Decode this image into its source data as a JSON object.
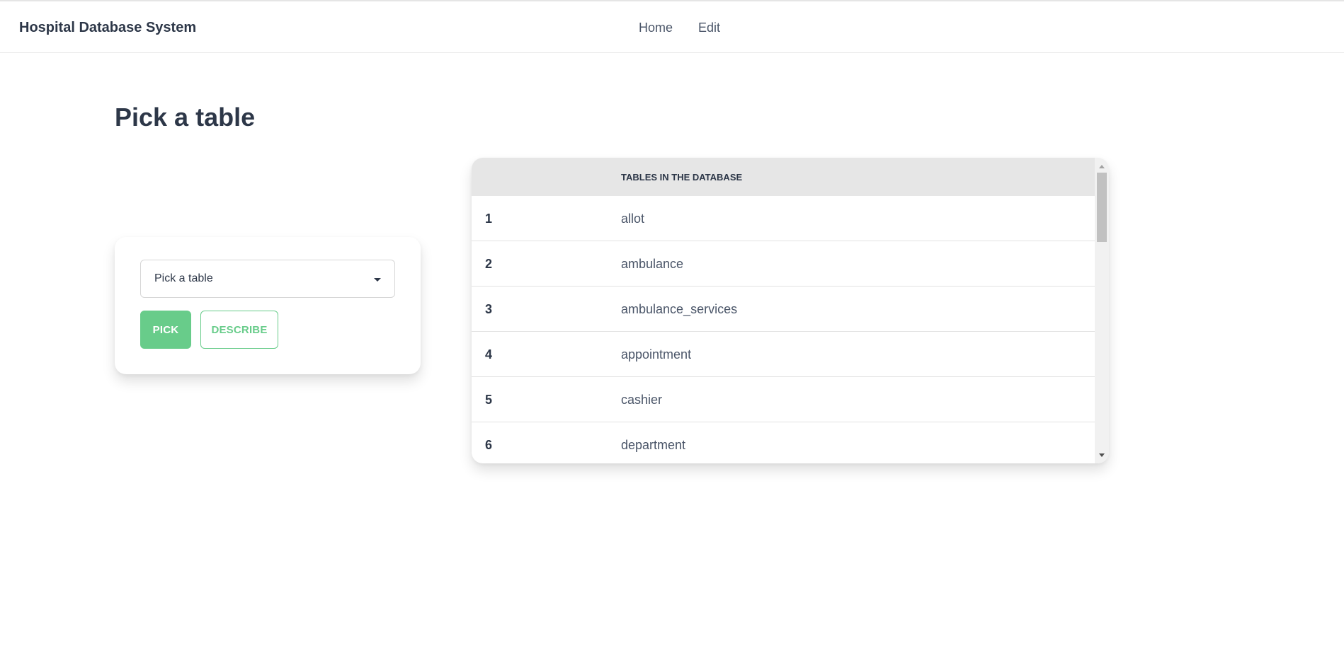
{
  "navbar": {
    "brand": "Hospital Database System",
    "links": [
      {
        "label": "Home"
      },
      {
        "label": "Edit"
      }
    ]
  },
  "page": {
    "title": "Pick a table"
  },
  "picker": {
    "select_value": "Pick a table",
    "pick_label": "PICK",
    "describe_label": "DESCRIBE"
  },
  "table": {
    "header": "TABLES IN THE DATABASE",
    "rows": [
      {
        "num": "1",
        "name": "allot"
      },
      {
        "num": "2",
        "name": "ambulance"
      },
      {
        "num": "3",
        "name": "ambulance_services"
      },
      {
        "num": "4",
        "name": "appointment"
      },
      {
        "num": "5",
        "name": "cashier"
      },
      {
        "num": "6",
        "name": "department"
      }
    ]
  },
  "colors": {
    "accent": "#68cc8a",
    "text": "#2d3748",
    "header_bg": "#e6e6e6"
  },
  "icons": {
    "select_caret": "caret-down-icon",
    "scroll_up": "scroll-up-arrow-icon",
    "scroll_down": "scroll-down-arrow-icon"
  }
}
